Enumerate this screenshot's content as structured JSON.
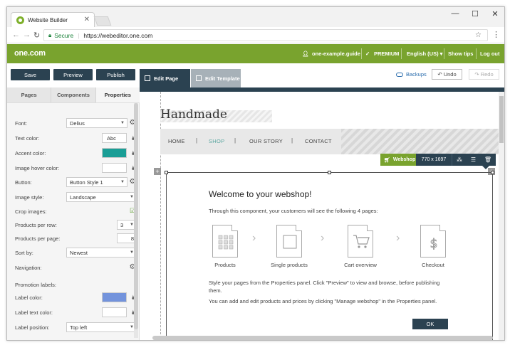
{
  "browser": {
    "tab_title": "Website Builder",
    "tab_close": "✕",
    "controls": {
      "minimize": "—",
      "maximize": "☐",
      "close": "✕"
    },
    "secure_label": "Secure",
    "separator": "|",
    "url": "https://webeditor.one.com"
  },
  "topnav": {
    "logo": "one.com",
    "user": "one-example.guide",
    "plan": "PREMIUM",
    "language": "English (US) ▾",
    "show_tips": "Show tips",
    "logout": "Log out",
    "brand_color": "#79a32e"
  },
  "toolbar": {
    "save": "Save",
    "preview": "Preview",
    "publish": "Publish",
    "edit_page": "Edit Page",
    "edit_template": "Edit Template",
    "backups": "Backups",
    "undo": "↶ Undo",
    "redo": "↷ Redo",
    "dark_color": "#2b4251"
  },
  "panel": {
    "tabs": [
      "Pages",
      "Components",
      "Properties"
    ],
    "active_tab": "Properties",
    "font_label": "Font:",
    "font_value": "Delius",
    "text_color_label": "Text color:",
    "text_color_value": "Abc",
    "accent_color_label": "Accent color:",
    "accent_color": "#1a9e96",
    "image_hover_label": "Image hover color:",
    "button_label": "Button:",
    "button_value": "Button Style 1",
    "image_style_label": "Image style:",
    "image_style_value": "Landscape",
    "crop_label": "Crop images:",
    "crop_checked": true,
    "products_row_label": "Products per row:",
    "products_row_value": "3",
    "products_page_label": "Products per page:",
    "products_page_value": "8",
    "sort_label": "Sort by:",
    "sort_value": "Newest",
    "navigation_label": "Navigation:",
    "promotion_label": "Promotion labels:",
    "label_color_label": "Label color:",
    "label_color": "#7393dc",
    "label_text_color_label": "Label text color:",
    "label_position_label": "Label position:",
    "label_position_value": "Top left"
  },
  "site": {
    "title": "Handmade",
    "nav": [
      "HOME",
      "SHOP",
      "OUR STORY",
      "CONTACT"
    ],
    "active_nav": "SHOP",
    "nav_separator": "|",
    "accent_color": "#5aa6a0"
  },
  "widget": {
    "name": "Webshop",
    "dimensions": "770 x 1697"
  },
  "modal": {
    "title": "Welcome to your webshop!",
    "intro": "Through this component, your customers will see the following 4 pages:",
    "steps": [
      "Products",
      "Single products",
      "Cart overview",
      "Checkout"
    ],
    "para1": "Style your pages from the Properties panel. Click \"Preview\" to view and browse, before publishing them.",
    "para2": "You can add and edit products and prices by clicking \"Manage webshop\" in the Properties panel.",
    "ok": "OK"
  }
}
